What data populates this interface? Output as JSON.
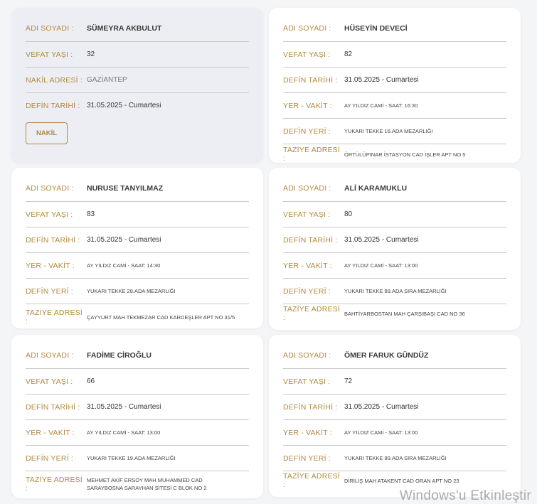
{
  "labels": {
    "name": "ADI SOYADI :",
    "age": "VEFAT YAŞI :",
    "transfer": "NAKİL ADRESİ :",
    "burial_date": "DEFİN TARİHİ :",
    "place_time": "YER - VAKİT :",
    "burial_place": "DEFİN YERİ :",
    "condolence": "TAZİYE ADRESİ :"
  },
  "cards": [
    {
      "name": "SÜMEYRA AKBULUT",
      "age": "32",
      "transfer": "GAZİANTEP",
      "burial_date": "31.05.2025 - Cumartesi",
      "button": "NAKİL"
    },
    {
      "name": "HÜSEYİN DEVECİ",
      "age": "82",
      "burial_date": "31.05.2025 - Cumartesi",
      "place_time": "AY YILDIZ CAMİ - SAAT: 16:30",
      "burial_place": "YUKARI TEKKE 16.ADA MEZARLIĞI",
      "condolence": "ÖRTÜLÜPINAR İSTASYON CAD İŞLER APT NO 5"
    },
    {
      "name": "NURUSE TANYILMAZ",
      "age": "83",
      "burial_date": "31.05.2025 - Cumartesi",
      "place_time": "AY YILDIZ CAMİ - SAAT: 14:30",
      "burial_place": "YUKARI TEKKE 28.ADA MEZARLIĞI",
      "condolence": "ÇAYYURT MAH TEKMEZAR CAD KARDEŞLER APT NO 31/5"
    },
    {
      "name": "ALİ KARAMUKLU",
      "age": "80",
      "burial_date": "31.05.2025 - Cumartesi",
      "place_time": "AY YILDIZ CAMİ - SAAT: 13:00",
      "burial_place": "YUKARI TEKKE 89.ADA SIRA MEZARLIĞI",
      "condolence": "BAHTİYARBOSTAN MAH ÇARŞIBAŞI CAD NO 36"
    },
    {
      "name": "FADİME CİROĞLU",
      "age": "66",
      "burial_date": "31.05.2025 - Cumartesi",
      "place_time": "AY YILDIZ CAMİ - SAAT: 13:00",
      "burial_place": "YUKARI TEKKE 19.ADA MEZARLIĞI",
      "condolence": "MEHMET AKİF ERSOY MAH MUHAMMED CAD SARAYBOSNA SARAYHAN SİTESİ C BLOK NO 2"
    },
    {
      "name": "ÖMER FARUK GÜNDÜZ",
      "age": "72",
      "burial_date": "31.05.2025 - Cumartesi",
      "place_time": "AY YILDIZ CAMİ - SAAT: 13:00",
      "burial_place": "YUKARI TEKKE 89.ADA SIRA MEZARLIĞI",
      "condolence": "DİRİLİŞ MAH ATAKENT CAD ORAN APT NO 23"
    }
  ],
  "watermark": "Windows'u Etkinleştir"
}
